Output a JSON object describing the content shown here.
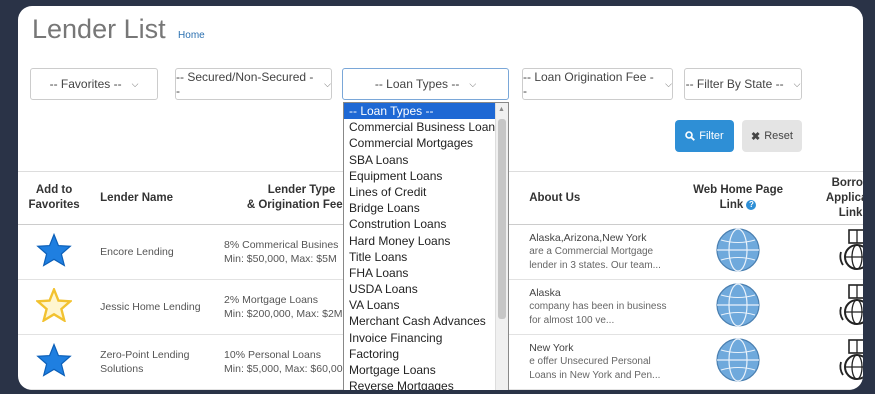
{
  "header": {
    "title": "Lender List",
    "breadcrumb": "Home"
  },
  "filters": [
    {
      "name": "favorites-select",
      "label": "-- Favorites --"
    },
    {
      "name": "secured-select",
      "label": "-- Secured/Non-Secured --"
    },
    {
      "name": "loan-types-select",
      "label": "-- Loan Types --"
    },
    {
      "name": "origination-fee-select",
      "label": "-- Loan Origination Fee --"
    },
    {
      "name": "state-select",
      "label": "-- Filter By State --"
    }
  ],
  "buttons": {
    "filter_label": "Filter",
    "reset_label": "Reset"
  },
  "dropdown": {
    "options": [
      "-- Loan Types --",
      "Commercial Business Loans",
      "Commercial Mortgages",
      "SBA Loans",
      "Equipment Loans",
      "Lines of Credit",
      "Bridge Loans",
      "Constrution Loans",
      "Hard Money Loans",
      "Title Loans",
      "FHA Loans",
      "USDA Loans",
      "VA Loans",
      "Merchant Cash Advances",
      "Invoice Financing",
      "Factoring",
      "Mortgage Loans",
      "Reverse Mortgages"
    ],
    "selected_index": 0
  },
  "table": {
    "headers": {
      "favorites_1": "Add to",
      "favorites_2": "Favorites",
      "name": "Lender Name",
      "type_1": "Lender Type",
      "type_2": "& Origination Fee %",
      "about": "About Us",
      "web_1": "Web Home Page",
      "web_2": "Link",
      "borrower_1": "Borrower Application",
      "borrower_2": "Link"
    },
    "rows": [
      {
        "favorite": true,
        "name": "Encore Lending",
        "type": "8% Commerical Busines",
        "fee": "Min: $50,000, Max: $5M",
        "states": "Alaska,Arizona,New York",
        "about": "are a Commercial Mortgage lender in 3 states. Our team..."
      },
      {
        "favorite": false,
        "name": "Jessic Home Lending",
        "type": "2% Mortgage Loans",
        "fee": "Min: $200,000, Max: $2M",
        "states": "Alaska",
        "about": "company has been in business for almost 100 ve..."
      },
      {
        "favorite": true,
        "name": "Zero-Point Lending Solutions",
        "type": "10% Personal Loans",
        "fee": "Min: $5,000, Max: $60,00",
        "states": "New York",
        "about": "e offer Unsecured Personal Loans in New York and Pen..."
      }
    ]
  },
  "colors": {
    "background": "#2a3347",
    "accent": "#2e8fd6",
    "star_filled": "#1f7fe0",
    "star_empty": "#f2c230",
    "dropdown_selected": "#1e68d4"
  },
  "icons": {
    "favorite_filled": "star-filled-icon",
    "favorite_empty": "star-outline-icon",
    "web_link": "globe-icon",
    "borrower_link": "globe-book-icon",
    "filter": "search-icon",
    "reset": "close-icon",
    "info": "info-icon"
  }
}
